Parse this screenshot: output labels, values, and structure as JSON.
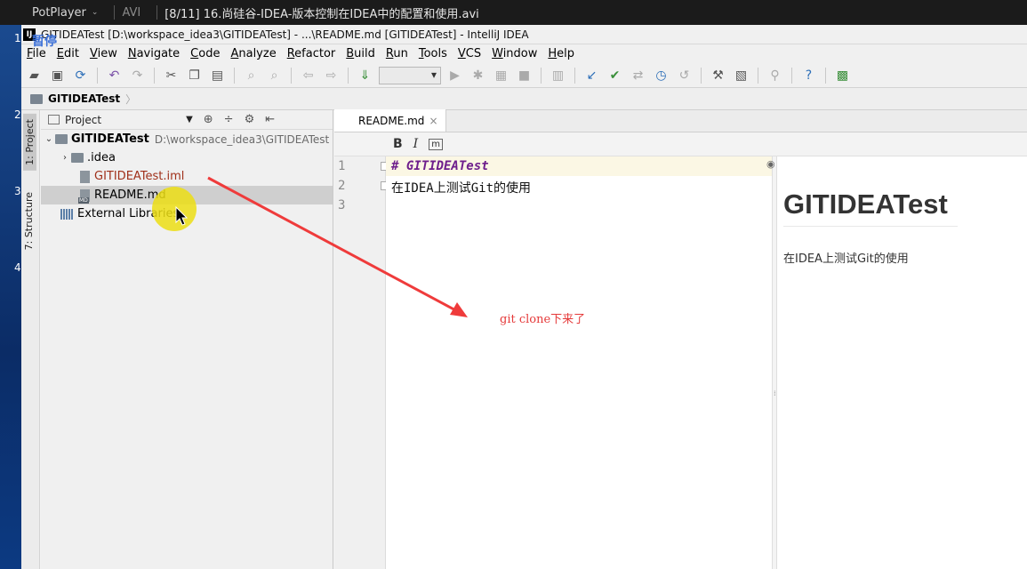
{
  "player": {
    "app_name": "PotPlayer",
    "format": "AVI",
    "video_title": "[8/11] 16.尚硅谷-IDEA-版本控制在IDEA中的配置和使用.avi"
  },
  "desktop": {
    "numbers": [
      "1",
      "2",
      "3",
      "4"
    ]
  },
  "idea": {
    "window_title": "GITIDEATest [D:\\workspace_idea3\\GITIDEATest] - ...\\README.md [GITIDEATest] - IntelliJ IDEA",
    "pause_overlay": "暂停",
    "menu": [
      "File",
      "Edit",
      "View",
      "Navigate",
      "Code",
      "Analyze",
      "Refactor",
      "Build",
      "Run",
      "Tools",
      "VCS",
      "Window",
      "Help"
    ],
    "breadcrumb": "GITIDEATest",
    "tool_windows": {
      "project": "1: Project",
      "structure": "7: Structure"
    },
    "project_panel": {
      "title": "Project",
      "root_name": "GITIDEATest",
      "root_path": "D:\\workspace_idea3\\GITIDEATest",
      "items": [
        ".idea",
        "GITIDEATest.iml",
        "README.md",
        "External Libraries"
      ]
    },
    "editor": {
      "tab_label": "README.md",
      "toolbar": {
        "bold": "B",
        "italic": "I",
        "code": "m"
      },
      "lines": [
        "# GITIDEATest",
        "在IDEA上测试Git的使用",
        ""
      ],
      "line_numbers": [
        "1",
        "2",
        "3"
      ],
      "preview_heading": "GITIDEATest",
      "preview_text": "在IDEA上测试Git的使用"
    }
  },
  "annotation": {
    "text": "git  clone下来了",
    "color": "#e53a3a"
  }
}
